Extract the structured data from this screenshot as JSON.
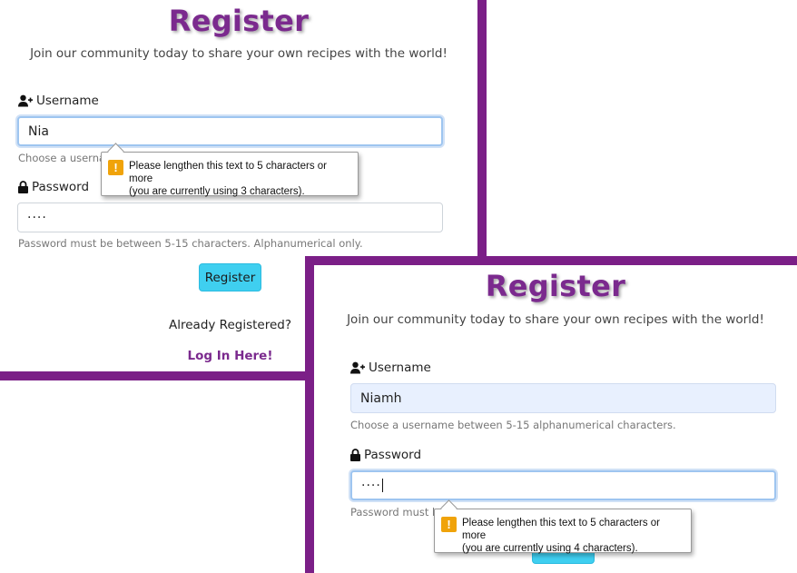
{
  "panel_top": {
    "title": "Register",
    "subtitle": "Join our community today to share your own recipes with the world!",
    "username_label": "Username",
    "username_value": "Nia",
    "username_help": "Choose a usernam",
    "password_label": "Password",
    "password_value": "····",
    "password_help": "Password must be between 5-15 characters. Alphanumerical only.",
    "register_button": "Register",
    "already_registered": "Already Registered?",
    "login_link": "Log In Here!",
    "tooltip_line1": "Please lengthen this text to 5 characters or more",
    "tooltip_line2": "(you are currently using 3 characters)."
  },
  "panel_bottom": {
    "title": "Register",
    "subtitle": "Join our community today to share your own recipes with the world!",
    "username_label": "Username",
    "username_value": "Niamh",
    "username_help": "Choose a username between 5-15 alphanumerical characters.",
    "password_label": "Password",
    "password_value": "····",
    "password_help": "Password must b",
    "tooltip_line1": "Please lengthen this text to 5 characters or more",
    "tooltip_line2": "(you are currently using 4 characters)."
  },
  "colors": {
    "brand_purple": "#7b1f87",
    "title_purple": "#7b2a8e",
    "button_cyan": "#3fcff0",
    "warning_orange": "#f0a30a"
  }
}
